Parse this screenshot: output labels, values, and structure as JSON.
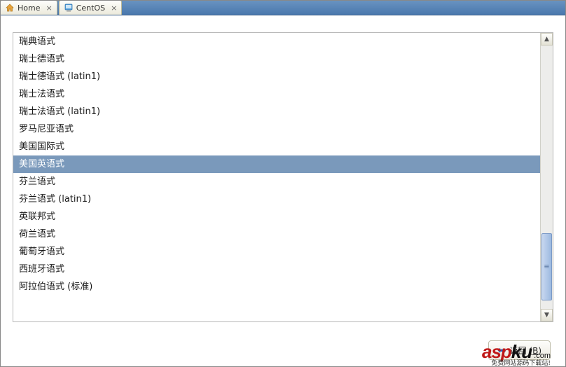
{
  "tabs": [
    {
      "label": "Home",
      "icon": "home"
    },
    {
      "label": "CentOS",
      "icon": "computer"
    }
  ],
  "keyboard_layouts": [
    "瑞典语式",
    "瑞士德语式",
    "瑞士德语式 (latin1)",
    "瑞士法语式",
    "瑞士法语式 (latin1)",
    "罗马尼亚语式",
    "美国国际式",
    "美国英语式",
    "芬兰语式",
    "芬兰语式 (latin1)",
    "英联邦式",
    "荷兰语式",
    "葡萄牙语式",
    "西班牙语式",
    "阿拉伯语式 (标准)"
  ],
  "selected_index": 7,
  "buttons": {
    "back_label": "返回",
    "back_key": "B"
  },
  "watermark": {
    "brand_left": "asp",
    "brand_right": "ku",
    "tld": ".com",
    "subtitle": "免费网站源码下载站!"
  }
}
